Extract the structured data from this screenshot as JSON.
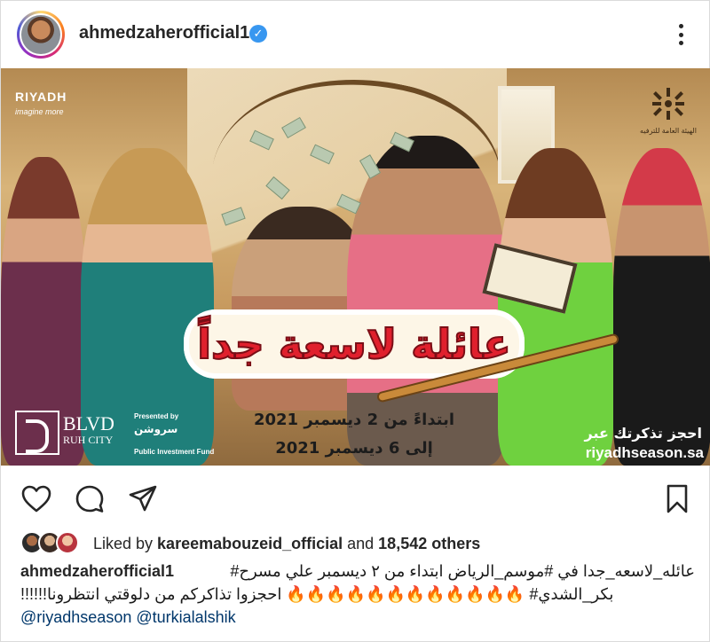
{
  "post": {
    "username": "ahmedzaherofficial1",
    "verified_icon": "verified-badge-icon",
    "more_icon": "more-options-icon"
  },
  "poster": {
    "brand_logo": "RIYADH",
    "brand_sub": "imagine more",
    "gea_text": "الهيئة العامة للترفيه",
    "title_ar": "عائلة لاسعة جداً",
    "date_from": "ابتداءً من 2 ديسمبر 2021",
    "date_to": "إلى 6 ديسمبر 2021",
    "book_ar": "احجز تذكرتك عبر",
    "book_site": "riyadhseason.sa",
    "blvd_name": "BLVD",
    "blvd_sub": "RUH CITY",
    "presented_by": "Presented by",
    "sponsor_ar": "سروشن",
    "pif": "Public Investment Fund"
  },
  "actions": {
    "like": "heart-icon",
    "comment": "comment-icon",
    "share": "share-icon",
    "save": "bookmark-icon"
  },
  "likes": {
    "prefix": "Liked by ",
    "user": "kareemabouzeid_official",
    "middle": " and ",
    "count": "18,542 others"
  },
  "caption": {
    "user": "ahmedzaherofficial1",
    "line1_ar": "عائله_لاسعه_جدا في #موسم_الرياض ابتداء من ٢ ديسمبر علي مسرح#",
    "line2_ar": "بكر_الشدي# 🔥🔥🔥🔥🔥🔥🔥🔥🔥🔥🔥🔥  احجزوا تذاكركم من دلوقتي انتظرونا!!!!!!",
    "mentions": "@riyadhseason @turkialalshik"
  }
}
